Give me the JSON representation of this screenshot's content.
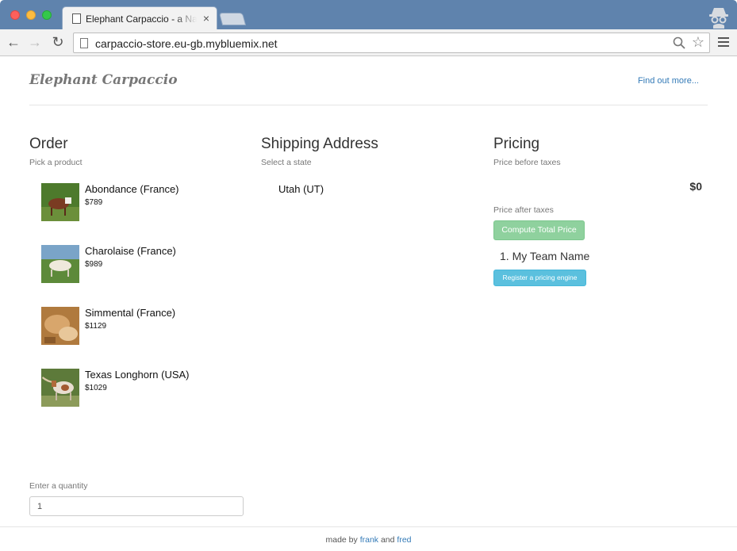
{
  "browser": {
    "tab_title": "Elephant Carpaccio - a Nano",
    "tab_close": "×",
    "url": "carpaccio-store.eu-gb.mybluemix.net"
  },
  "header": {
    "brand": "Elephant Carpaccio",
    "find_out_more": "Find out more..."
  },
  "order": {
    "title": "Order",
    "subtitle": "Pick a product",
    "products": [
      {
        "name": "Abondance (France)",
        "price": "$789"
      },
      {
        "name": "Charolaise (France)",
        "price": "$989"
      },
      {
        "name": "Simmental (France)",
        "price": "$1129"
      },
      {
        "name": "Texas Longhorn (USA)",
        "price": "$1029"
      }
    ],
    "quantity_label": "Enter a quantity",
    "quantity_value": "1"
  },
  "shipping": {
    "title": "Shipping Address",
    "subtitle": "Select a state",
    "state": "Utah (UT)"
  },
  "pricing": {
    "title": "Pricing",
    "subtitle": "Price before taxes",
    "price_before": "$0",
    "after_label": "Price after taxes",
    "compute_button": "Compute Total Price",
    "team_entry": "1. My Team Name",
    "register_button": "Register a pricing engine"
  },
  "footer": {
    "prefix": "made by ",
    "author1": "frank",
    "conjunction": " and ",
    "author2": "fred"
  },
  "colors": {
    "link": "#337ab7",
    "success_button": "#8fd19e",
    "info_button": "#5bc0de",
    "titlebar": "#5f83ad"
  }
}
